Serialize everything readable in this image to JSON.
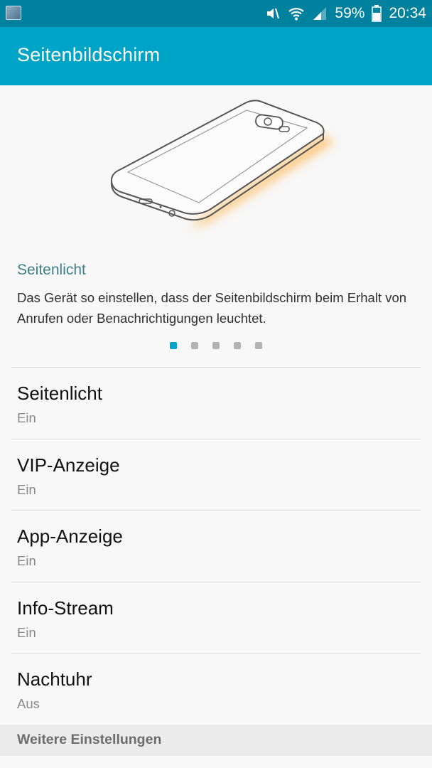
{
  "status_bar": {
    "battery_percent": "59%",
    "time": "20:34",
    "icons": [
      "gallery-thumbnail-icon",
      "mute-icon",
      "wifi-icon",
      "signal-icon",
      "battery-icon"
    ]
  },
  "app_bar": {
    "title": "Seitenbildschirm"
  },
  "feature_pager": {
    "illustration": "phone-edge-lighting-illustration",
    "title": "Seitenlicht",
    "description": "Das Gerät so einstellen, dass der Seitenbildschirm beim Erhalt von Anrufen oder Benachrichtigungen leuchtet.",
    "page_count": 5,
    "active_page": 1
  },
  "settings": [
    {
      "title": "Seitenlicht",
      "status": "Ein"
    },
    {
      "title": "VIP-Anzeige",
      "status": "Ein"
    },
    {
      "title": "App-Anzeige",
      "status": "Ein"
    },
    {
      "title": "Info-Stream",
      "status": "Ein"
    },
    {
      "title": "Nachtuhr",
      "status": "Aus"
    }
  ],
  "section_header": {
    "label": "Weitere Einstellungen"
  },
  "colors": {
    "status_bar": "#00829f",
    "app_bar": "#00a4c6",
    "accent": "#00a4c6",
    "glow": "#ffb347"
  }
}
